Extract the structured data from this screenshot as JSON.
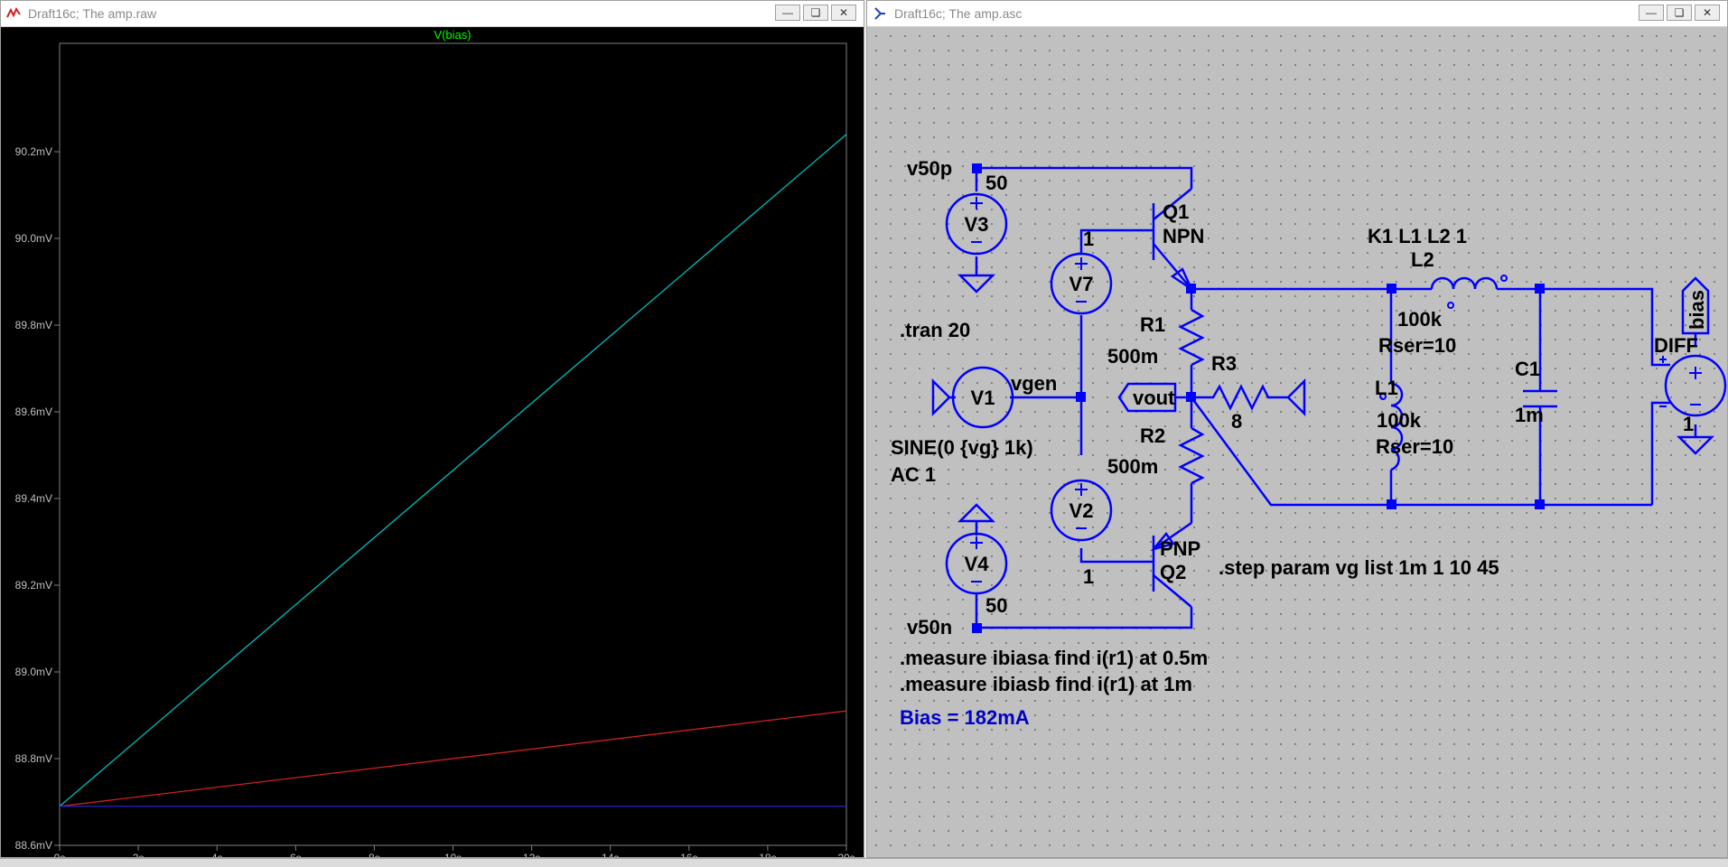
{
  "plot_window": {
    "title": "Draft16c; The amp.raw",
    "controls": [
      "minimize",
      "restore",
      "close"
    ]
  },
  "schematic_window": {
    "title": "Draft16c; The amp.asc",
    "controls": [
      "minimize",
      "restore",
      "close"
    ]
  },
  "chart_data": {
    "type": "line",
    "title": "V(bias)",
    "xlabel": "",
    "ylabel": "",
    "x_ticks": [
      "0s",
      "2s",
      "4s",
      "6s",
      "8s",
      "10s",
      "12s",
      "14s",
      "16s",
      "18s",
      "20s"
    ],
    "y_ticks": [
      "88.6mV",
      "88.8mV",
      "89.0mV",
      "89.2mV",
      "89.4mV",
      "89.6mV",
      "89.8mV",
      "90.0mV",
      "90.2mV"
    ],
    "xlim": [
      0,
      20
    ],
    "ylim": [
      88.6,
      90.45
    ],
    "grid": false,
    "colors": {
      "background": "#000000",
      "frame": "#808080",
      "title": "#00ff00",
      "ticks": "#c0c0c0"
    },
    "series": [
      {
        "color": "#00bfbf",
        "x": [
          0,
          20
        ],
        "y": [
          88.69,
          90.24
        ]
      },
      {
        "color": "#d02020",
        "x": [
          0,
          20
        ],
        "y": [
          88.69,
          88.91
        ]
      },
      {
        "color": "#2020c0",
        "x": [
          0,
          20
        ],
        "y": [
          88.69,
          88.69
        ]
      }
    ]
  },
  "schematic": {
    "labels": {
      "v50p": "v50p",
      "v50n": "v50n",
      "n50a": "50",
      "n50b": "50",
      "v3": "V3",
      "v4": "V4",
      "v7": "V7",
      "v2": "V2",
      "v1": "V1",
      "q1_num": "1",
      "q1": "Q1",
      "npn": "NPN",
      "q2_num": "1",
      "q2": "Q2",
      "pnp": "PNP",
      "r1": "R1",
      "r1_val": "500m",
      "r2": "R2",
      "r2_val": "500m",
      "r3": "R3",
      "r3_val": "8",
      "vgen": "vgen",
      "vout": "vout",
      "k1": "K1 L1 L2 1",
      "l2": "L2",
      "l2_val": "100k",
      "l2_rser": "Rser=10",
      "l1": "L1",
      "l1_val": "100k",
      "l1_rser": "Rser=10",
      "c1": "C1",
      "c1_val": "1m",
      "diff": "DIFF",
      "diff_gain": "1",
      "bias": "bias",
      "tran": ".tran 20",
      "sine": "SINE(0 {vg} 1k)",
      "ac": "AC 1",
      "step": ".step param vg list 1m 1 10 45",
      "meas_a": ".measure ibiasa find i(r1) at 0.5m",
      "meas_b": ".measure ibiasb find i(r1) at 1m",
      "result": "Bias = 182mA"
    },
    "colors": {
      "wire": "#0000ff",
      "text": "#000000",
      "result": "#0000c8",
      "background": "#c0c0c0"
    }
  }
}
